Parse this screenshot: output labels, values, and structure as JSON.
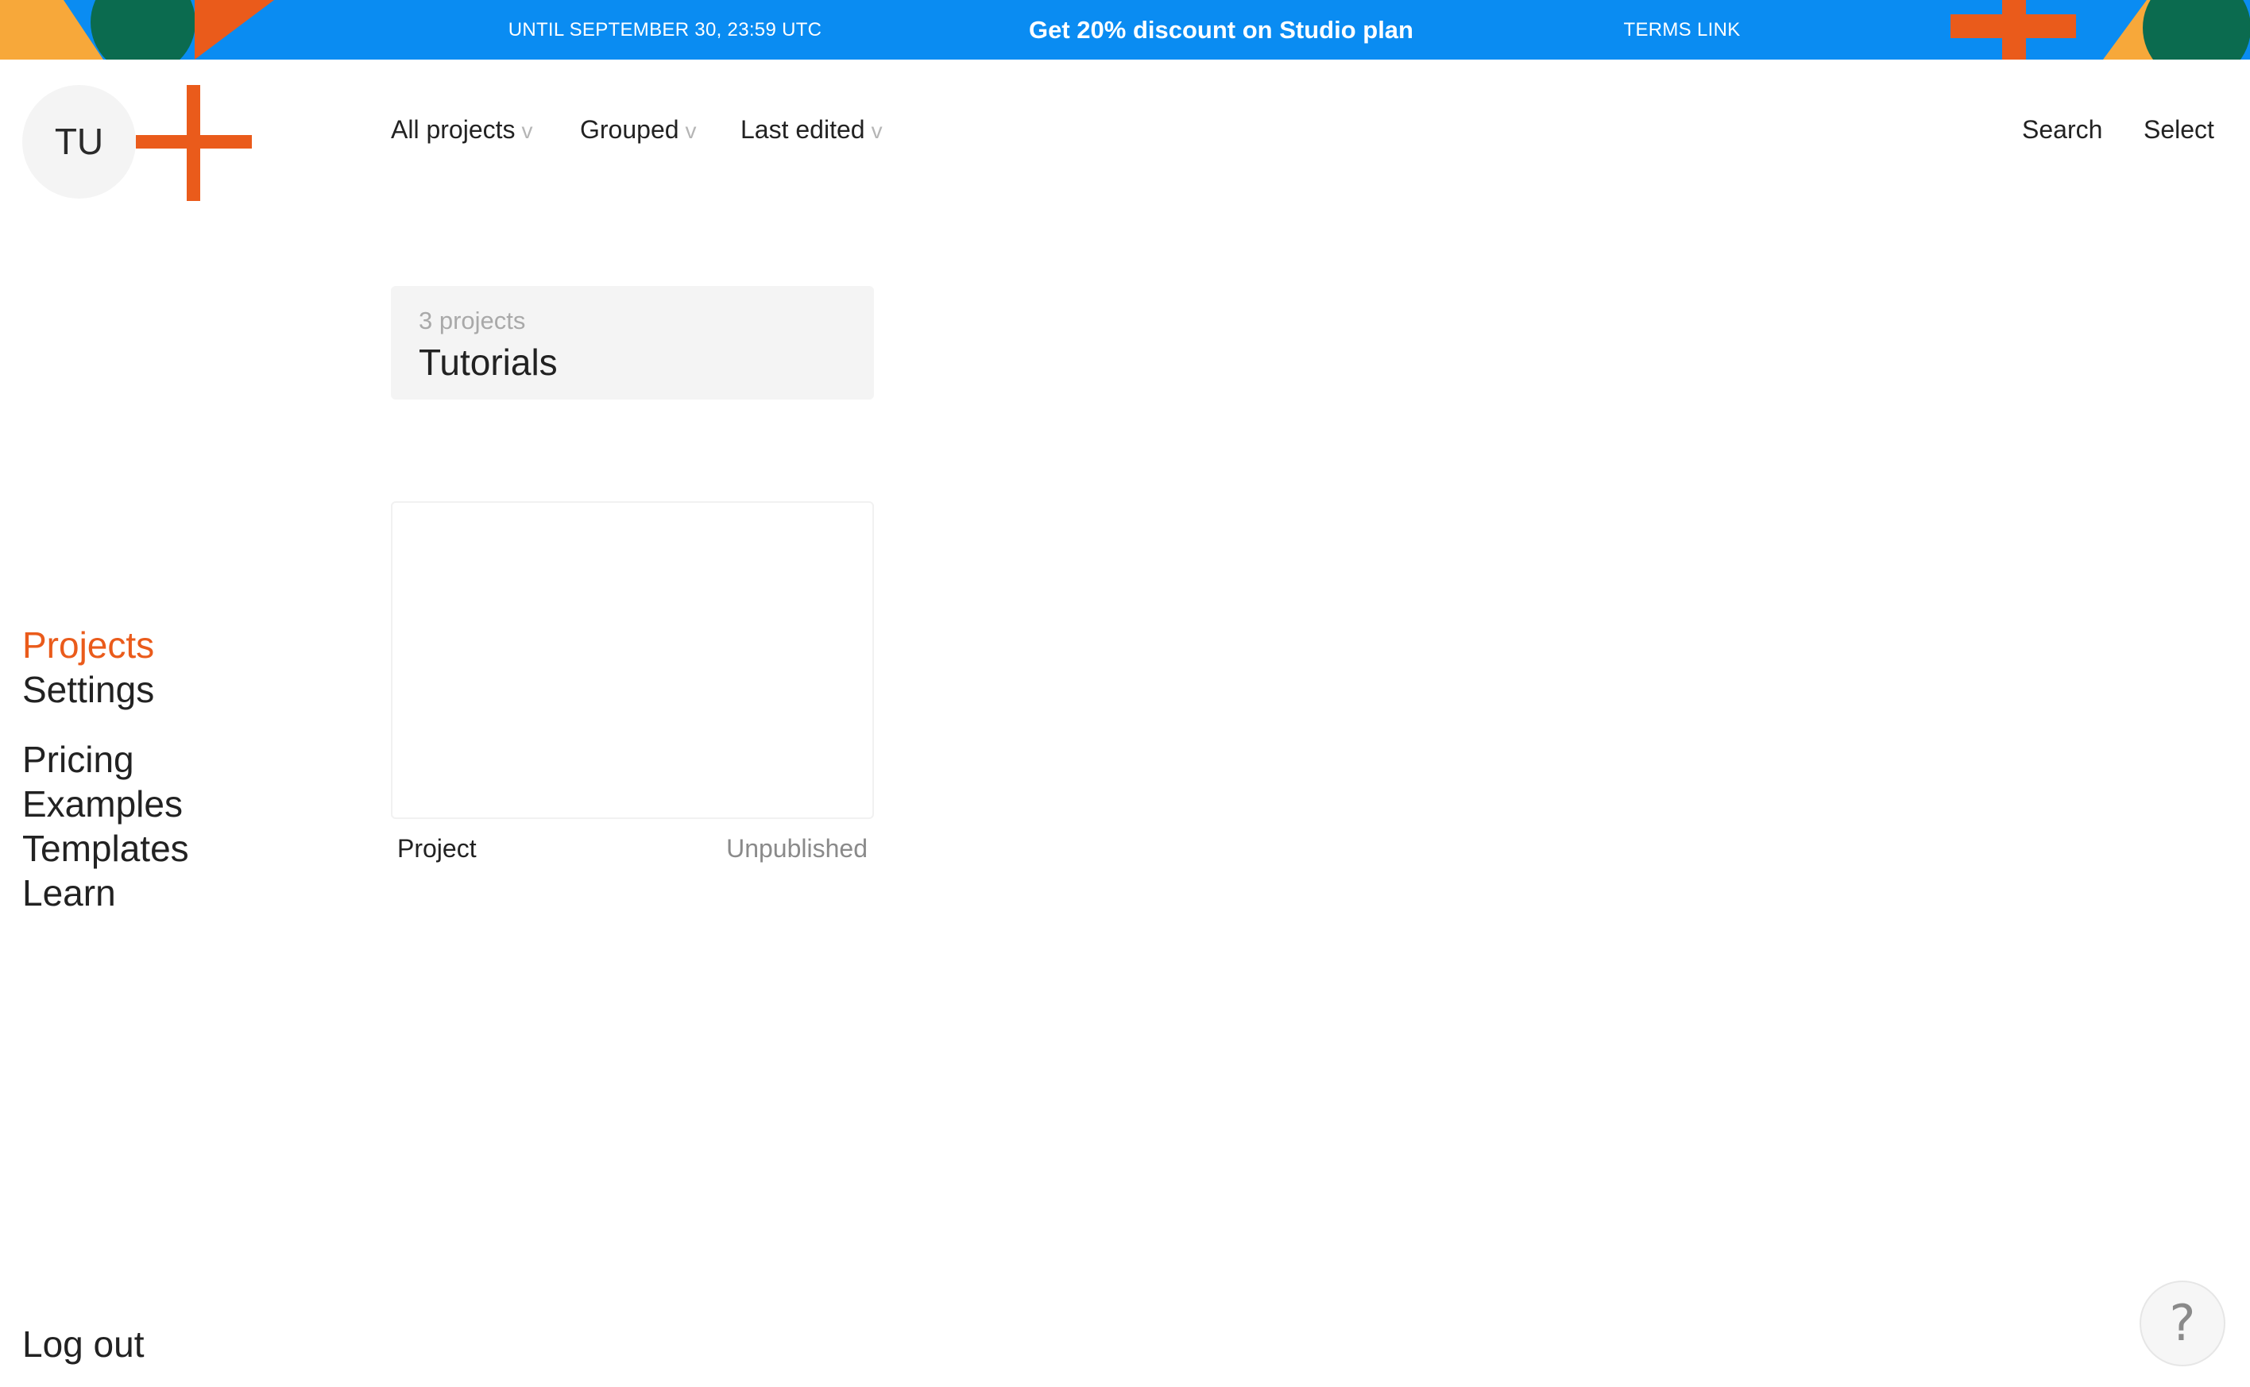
{
  "colors": {
    "banner_bg": "#0a8cf2",
    "accent_orange": "#ea5b1b",
    "accent_green": "#0b6b4f",
    "accent_yellow": "#f7a83a",
    "muted_text": "#a9a9a9",
    "card_bg": "#f4f4f4"
  },
  "banner": {
    "until": "UNTIL SEPTEMBER 30, 23:59 UTC",
    "offer": "Get 20% discount on Studio plan",
    "terms": "TERMS LINK"
  },
  "logo": {
    "avatar_initials": "TU",
    "brand_icon": "plus-icon"
  },
  "toolbar": {
    "filter_label": "All projects",
    "group_label": "Grouped",
    "sort_label": "Last edited",
    "chevron": "v",
    "search_label": "Search",
    "select_label": "Select"
  },
  "folder": {
    "count_text": "3 projects",
    "name": "Tutorials"
  },
  "project": {
    "name": "Project",
    "status": "Unpublished"
  },
  "nav": {
    "primary": [
      "Projects",
      "Settings"
    ],
    "secondary": [
      "Pricing",
      "Examples",
      "Templates",
      "Learn"
    ],
    "active": "Projects",
    "logout": "Log out"
  },
  "help": {
    "glyph": "?",
    "icon": "help-icon"
  }
}
